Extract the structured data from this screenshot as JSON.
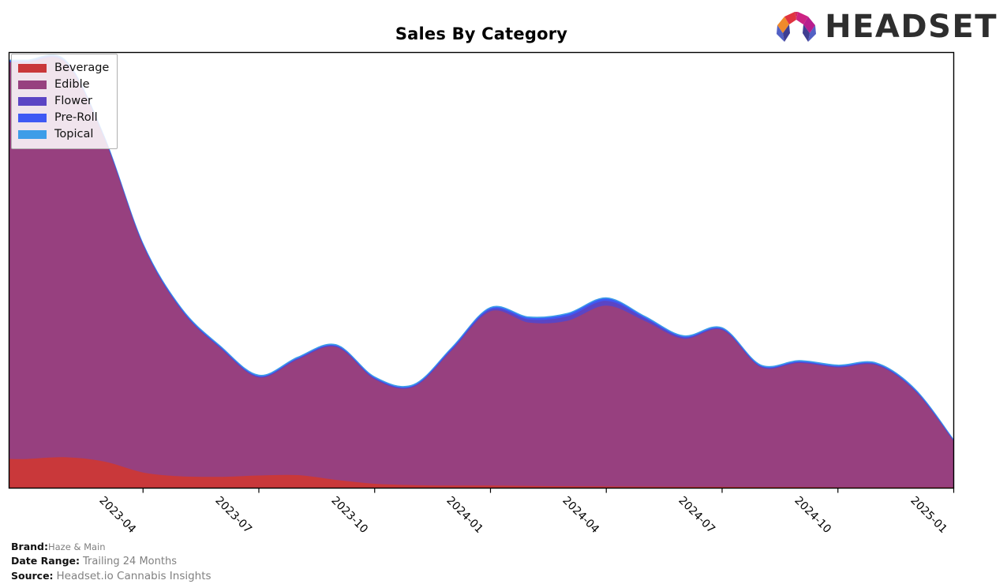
{
  "header": {
    "title": "Sales By Category",
    "logo_text": "HEADSET",
    "logo_icon": "headset-arch-logo"
  },
  "legend": {
    "position": "upper-left",
    "items": [
      {
        "label": "Beverage",
        "color": "#c9383a"
      },
      {
        "label": "Edible",
        "color": "#97407f"
      },
      {
        "label": "Flower",
        "color": "#5b45c4"
      },
      {
        "label": "Pre-Roll",
        "color": "#3f59f4"
      },
      {
        "label": "Topical",
        "color": "#3d9de8"
      }
    ]
  },
  "footer": {
    "brand_key": "Brand:",
    "brand_value": "Haze & Main",
    "date_range_key": "Date Range:",
    "date_range_value": "Trailing 24 Months",
    "source_key": "Source:",
    "source_value": "Headset.io Cannabis Insights"
  },
  "chart_data": {
    "type": "area",
    "stacked": true,
    "title": "Sales By Category",
    "xlabel": "",
    "ylabel": "",
    "grid": false,
    "legend_position": "upper-left",
    "y_axis_labels_visible": false,
    "x_tick_labels": [
      "2023-04",
      "2023-07",
      "2023-10",
      "2024-01",
      "2024-04",
      "2024-07",
      "2024-10",
      "2025-01"
    ],
    "x": [
      "2023-01",
      "2023-02",
      "2023-03",
      "2023-04",
      "2023-05",
      "2023-06",
      "2023-07",
      "2023-08",
      "2023-09",
      "2023-10",
      "2023-11",
      "2023-12",
      "2024-01",
      "2024-02",
      "2024-03",
      "2024-04",
      "2024-05",
      "2024-06",
      "2024-07",
      "2024-08",
      "2024-09",
      "2024-10",
      "2024-11",
      "2024-12",
      "2025-01"
    ],
    "xlim": [
      "2022-12-20",
      "2025-01-01"
    ],
    "ylim": [
      0,
      100
    ],
    "series": [
      {
        "name": "Beverage",
        "color": "#c9383a",
        "values": [
          6.6,
          7.0,
          6.0,
          3.5,
          2.6,
          2.5,
          2.8,
          2.9,
          1.8,
          0.9,
          0.6,
          0.5,
          0.5,
          0.4,
          0.35,
          0.3,
          0.25,
          0.2,
          0.2,
          0.15,
          0.15,
          0.1,
          0.1,
          0.1,
          0.1
        ]
      },
      {
        "name": "Edible",
        "color": "#97407f",
        "values": [
          91.0,
          90.5,
          74.0,
          52.0,
          38.0,
          29.5,
          22.5,
          26.5,
          30.5,
          24.0,
          22.5,
          31.0,
          40.0,
          37.5,
          38.0,
          41.5,
          38.0,
          34.0,
          36.0,
          27.5,
          28.5,
          27.5,
          28.0,
          22.0,
          10.5
        ]
      },
      {
        "name": "Flower",
        "color": "#5b45c4",
        "values": [
          0.2,
          0.2,
          0.2,
          0.2,
          0.2,
          0.2,
          0.2,
          0.2,
          0.2,
          0.2,
          0.2,
          0.3,
          0.4,
          0.7,
          1.0,
          1.1,
          0.6,
          0.3,
          0.2,
          0.2,
          0.2,
          0.2,
          0.2,
          0.2,
          0.15
        ]
      },
      {
        "name": "Pre-Roll",
        "color": "#3f59f4",
        "values": [
          0.15,
          0.15,
          0.15,
          0.15,
          0.15,
          0.15,
          0.15,
          0.15,
          0.15,
          0.15,
          0.15,
          0.2,
          0.3,
          0.4,
          0.5,
          0.5,
          0.3,
          0.2,
          0.15,
          0.15,
          0.15,
          0.15,
          0.15,
          0.15,
          0.1
        ]
      },
      {
        "name": "Topical",
        "color": "#3d9de8",
        "values": [
          0.3,
          0.3,
          0.3,
          0.3,
          0.3,
          0.3,
          0.3,
          0.3,
          0.3,
          0.3,
          0.3,
          0.3,
          0.3,
          0.3,
          0.3,
          0.3,
          0.3,
          0.3,
          0.3,
          0.3,
          0.3,
          0.3,
          0.3,
          0.3,
          0.25
        ]
      }
    ]
  }
}
